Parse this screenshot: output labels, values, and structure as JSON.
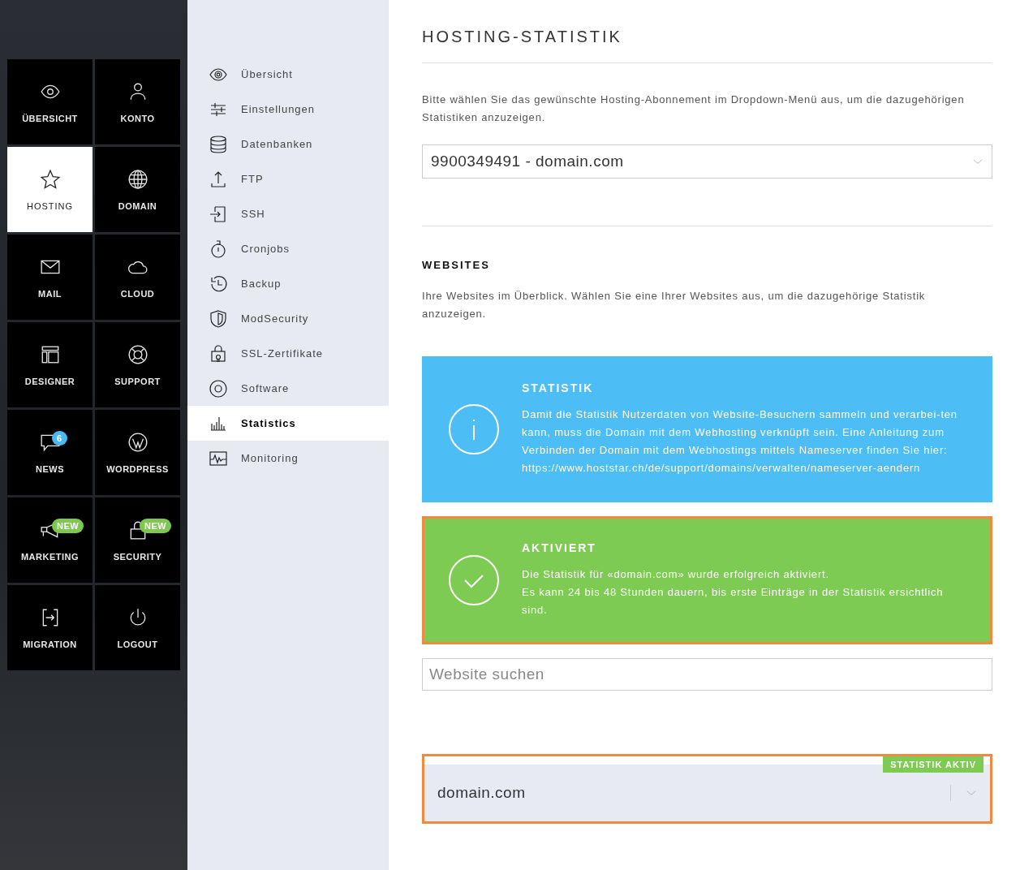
{
  "tiles": [
    {
      "label": "ÜBERSICHT",
      "selected": false
    },
    {
      "label": "KONTO",
      "selected": false
    },
    {
      "label": "HOSTING",
      "selected": true
    },
    {
      "label": "DOMAIN",
      "selected": false
    },
    {
      "label": "MAIL",
      "selected": false
    },
    {
      "label": "CLOUD",
      "selected": false
    },
    {
      "label": "DESIGNER",
      "selected": false
    },
    {
      "label": "SUPPORT",
      "selected": false
    },
    {
      "label": "NEWS",
      "selected": false,
      "badge": {
        "text": "6",
        "color": "#4cb8f0"
      }
    },
    {
      "label": "WORDPRESS",
      "selected": false
    },
    {
      "label": "MARKETING",
      "selected": false,
      "badge": {
        "text": "NEW",
        "color": "#7ec850"
      }
    },
    {
      "label": "SECURITY",
      "selected": false,
      "badge": {
        "text": "NEW",
        "color": "#7ec850"
      }
    },
    {
      "label": "MIGRATION",
      "selected": false
    },
    {
      "label": "LOGOUT",
      "selected": false
    }
  ],
  "submenu": [
    {
      "label": "Übersicht",
      "selected": false
    },
    {
      "label": "Einstellungen",
      "selected": false
    },
    {
      "label": "Datenbanken",
      "selected": false
    },
    {
      "label": "FTP",
      "selected": false
    },
    {
      "label": "SSH",
      "selected": false
    },
    {
      "label": "Cronjobs",
      "selected": false
    },
    {
      "label": "Backup",
      "selected": false
    },
    {
      "label": "ModSecurity",
      "selected": false
    },
    {
      "label": "SSL-Zertifikate",
      "selected": false
    },
    {
      "label": "Software",
      "selected": false
    },
    {
      "label": "Statistics",
      "selected": true
    },
    {
      "label": "Monitoring",
      "selected": false
    }
  ],
  "main": {
    "title": "HOSTING-STATISTIK",
    "intro": "Bitte wählen Sie das gewünschte Hosting-Abonnement im Dropdown-Menü aus, um die dazugehörigen Statistiken anzuzeigen.",
    "subscription_dropdown": {
      "value": "9900349491 - domain.com"
    },
    "websites": {
      "heading": "WEBSITES",
      "description": "Ihre Websites im Überblick. Wählen Sie eine Ihrer Websites aus, um die dazugehörige Statistik anzuzeigen."
    },
    "notices": [
      {
        "kind": "info",
        "highlighted": false,
        "title": "STATISTIK",
        "lines": [
          "Damit die Statistik Nutzerdaten von Website-Besuchern sammeln und verarbei-ten kann, muss die Domain mit dem Webhosting verknüpft sein. Eine Anleitung zum Verbinden der Domain mit dem Webhostings mittels Nameserver finden Sie hier: https://www.hoststar.ch/de/support/domains/verwalten/nameserver-aendern"
        ]
      },
      {
        "kind": "success",
        "highlighted": true,
        "title": "AKTIVIERT",
        "lines": [
          "Die Statistik für «domain.com» wurde erfolgreich aktiviert.",
          "Es kann 24 bis 48 Stunden dauern, bis erste Einträge in der Statistik ersichtlich sind."
        ]
      }
    ],
    "search": {
      "placeholder": "Website suchen"
    },
    "website_rows": [
      {
        "domain": "domain.com",
        "badge": "STATISTIK AKTIV",
        "highlighted": true
      }
    ]
  }
}
